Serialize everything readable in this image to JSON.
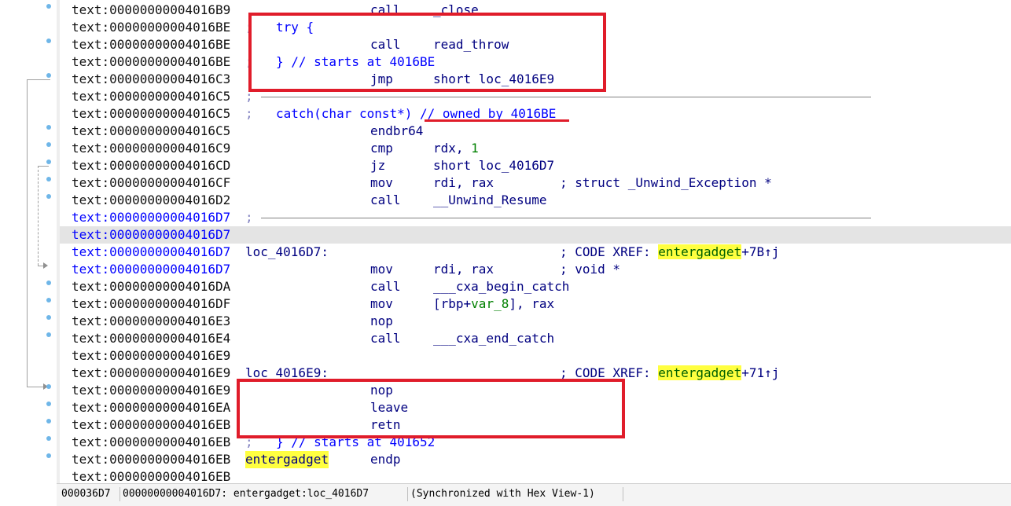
{
  "listing": {
    "rows": [
      {
        "addr": "text:00000000004016B9",
        "label": "",
        "mnemonic": "call",
        "operand": "_close",
        "comment": ""
      },
      {
        "addr": "text:00000000004016BE",
        "semi": ";",
        "cmt": "try {"
      },
      {
        "addr": "text:00000000004016BE",
        "label": "",
        "mnemonic": "call",
        "operand": "read_throw",
        "comment": ""
      },
      {
        "addr": "text:00000000004016BE",
        "semi": ";",
        "cmt": "} // starts at 4016BE"
      },
      {
        "addr": "text:00000000004016C3",
        "label": "",
        "mnemonic": "jmp",
        "operand": "short loc_4016E9",
        "comment": ""
      },
      {
        "addr": "text:00000000004016C5",
        "semi": ";",
        "cmt": ""
      },
      {
        "addr": "text:00000000004016C5",
        "semi": ";",
        "cmt": "catch(char const*) // owned by 4016BE"
      },
      {
        "addr": "text:00000000004016C5",
        "label": "",
        "mnemonic": "endbr64",
        "operand": "",
        "comment": ""
      },
      {
        "addr": "text:00000000004016C9",
        "label": "",
        "mnemonic": "cmp",
        "operand": "rdx, ",
        "num": "1",
        "comment": ""
      },
      {
        "addr": "text:00000000004016CD",
        "label": "",
        "mnemonic": "jz",
        "operand": "short loc_4016D7",
        "comment": ""
      },
      {
        "addr": "text:00000000004016CF",
        "label": "",
        "mnemonic": "mov",
        "operand": "rdi, rax",
        "comment": "; struct _Unwind_Exception *"
      },
      {
        "addr": "text:00000000004016D2",
        "label": "",
        "mnemonic": "call",
        "operand": "__Unwind_Resume",
        "comment": ""
      },
      {
        "addr": "text:00000000004016D7",
        "semi": ";",
        "cmt": "",
        "blue": true
      },
      {
        "addr": "text:00000000004016D7",
        "label": "",
        "mnemonic": "",
        "operand": "",
        "comment": "",
        "blue": true,
        "highlight": true
      },
      {
        "addr": "text:00000000004016D7",
        "label": "loc_4016D7:",
        "mnemonic": "",
        "operand": "",
        "comment": "; CODE XREF: ",
        "xref": "entergadget",
        "xref_tail": "+7B↑j",
        "blue": true
      },
      {
        "addr": "text:00000000004016D7",
        "label": "",
        "mnemonic": "mov",
        "operand": "rdi, rax",
        "comment": "; void *",
        "blue": true
      },
      {
        "addr": "text:00000000004016DA",
        "label": "",
        "mnemonic": "call",
        "operand": "___cxa_begin_catch",
        "comment": ""
      },
      {
        "addr": "text:00000000004016DF",
        "label": "",
        "mnemonic": "mov",
        "operand": "[rbp+",
        "var": "var_8",
        "operand_tail": "], rax",
        "comment": ""
      },
      {
        "addr": "text:00000000004016E3",
        "label": "",
        "mnemonic": "nop",
        "operand": "",
        "comment": ""
      },
      {
        "addr": "text:00000000004016E4",
        "label": "",
        "mnemonic": "call",
        "operand": "___cxa_end_catch",
        "comment": ""
      },
      {
        "addr": "text:00000000004016E9",
        "label": "",
        "mnemonic": "",
        "operand": "",
        "comment": ""
      },
      {
        "addr": "text:00000000004016E9",
        "label": "loc_4016E9:",
        "mnemonic": "",
        "operand": "",
        "comment": "; CODE XREF: ",
        "xref": "entergadget",
        "xref_tail": "+71↑j"
      },
      {
        "addr": "text:00000000004016E9",
        "label": "",
        "mnemonic": "nop",
        "operand": "",
        "comment": ""
      },
      {
        "addr": "text:00000000004016EA",
        "label": "",
        "mnemonic": "leave",
        "operand": "",
        "comment": ""
      },
      {
        "addr": "text:00000000004016EB",
        "label": "",
        "mnemonic": "retn",
        "operand": "",
        "comment": ""
      },
      {
        "addr": "text:00000000004016EB",
        "semi": ";",
        "cmt": "} // starts at 401652"
      },
      {
        "addr": "text:00000000004016EB",
        "label": "entergadget",
        "label_yellow": true,
        "mnemonic": "endp",
        "operand": "",
        "comment": ""
      },
      {
        "addr": "text:00000000004016EB",
        "label": "",
        "mnemonic": "",
        "operand": "",
        "comment": ""
      }
    ]
  },
  "status_bar": {
    "offset": "000036D7",
    "location": "00000000004016D7: entergadget:loc_4016D7",
    "sync": "(Synchronized with Hex View-1)"
  },
  "colors": {
    "annotation_red": "#e01c2a",
    "highlight_yellow": "#ffff40",
    "address_blue": "#0000ff",
    "code_navy": "#000080"
  }
}
